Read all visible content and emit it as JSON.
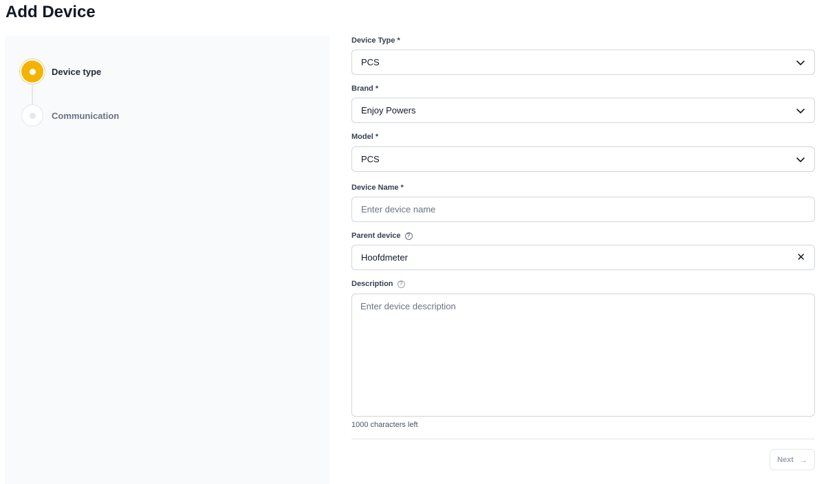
{
  "page": {
    "title": "Add Device"
  },
  "stepper": {
    "steps": [
      {
        "label": "Device type",
        "state": "active"
      },
      {
        "label": "Communication",
        "state": "inactive"
      }
    ]
  },
  "form": {
    "device_type": {
      "label": "Device Type *",
      "value": "PCS"
    },
    "brand": {
      "label": "Brand *",
      "value": "Enjoy Powers"
    },
    "model": {
      "label": "Model *",
      "value": "PCS"
    },
    "device_name": {
      "label": "Device Name *",
      "value": "",
      "placeholder": "Enter device name"
    },
    "parent_device": {
      "label": "Parent device",
      "value": "Hoofdmeter"
    },
    "description": {
      "label": "Description",
      "value": "",
      "placeholder": "Enter device description",
      "char_count": "1000 characters left"
    },
    "help_icon_glyph": "?",
    "clear_glyph": "✕",
    "next_button": {
      "label": "Next",
      "icon": "→"
    }
  },
  "colors": {
    "accent": "#f5b301",
    "panel_bg": "#f8fafc",
    "border": "#d1d5db"
  }
}
